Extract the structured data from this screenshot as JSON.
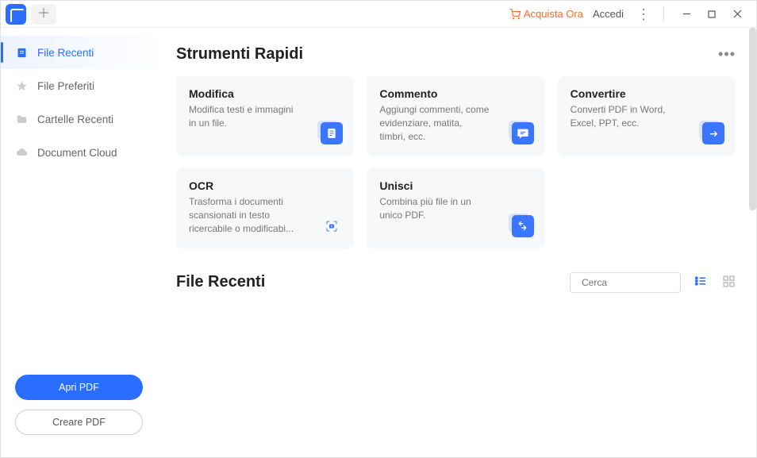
{
  "titlebar": {
    "buyNow": "Acquista Ora",
    "login": "Accedi"
  },
  "sidebar": {
    "items": [
      {
        "label": "File Recenti",
        "icon": "doc-list",
        "active": true
      },
      {
        "label": "File Preferiti",
        "icon": "star",
        "active": false
      },
      {
        "label": "Cartelle Recenti",
        "icon": "folder",
        "active": false
      },
      {
        "label": "Document Cloud",
        "icon": "cloud",
        "active": false
      }
    ],
    "open": "Apri PDF",
    "create": "Creare PDF"
  },
  "main": {
    "quickTitle": "Strumenti Rapidi",
    "cards": [
      {
        "title": "Modifica",
        "desc": "Modifica testi e immagini in un file."
      },
      {
        "title": "Commento",
        "desc": "Aggiungi commenti, come evidenziare, matita, timbri, ecc."
      },
      {
        "title": "Convertire",
        "desc": "Converti PDF in Word, Excel, PPT, ecc."
      },
      {
        "title": "OCR",
        "desc": "Trasforma i documenti scansionati in testo ricercabile o modificabi..."
      },
      {
        "title": "Unisci",
        "desc": "Combina più file in un unico PDF."
      }
    ],
    "recentTitle": "File Recenti",
    "searchPlaceholder": "Cerca"
  }
}
